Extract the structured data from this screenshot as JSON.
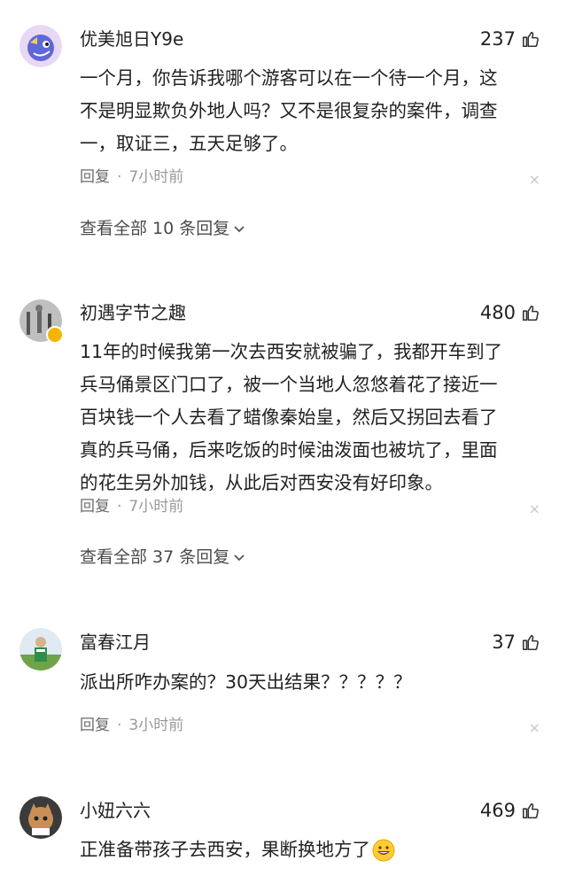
{
  "comments": [
    {
      "username": "优美旭日Y9e",
      "likes": "237",
      "lines": [
        "一个月，你告诉我哪个游客可以在一个待一个月，这",
        "不是明显欺负外地人吗？又不是很复杂的案件，调查",
        "一，取证三，五天足够了。"
      ],
      "reply_label": "回复",
      "separator": "·",
      "time": "7小时前",
      "view_all": "查看全部 10 条回复"
    },
    {
      "username": "初遇字节之趣",
      "likes": "480",
      "lines": [
        "11年的时候我第一次去西安就被骗了，我都开车到了",
        "兵马俑景区门口了，被一个当地人忽悠着花了接近一",
        "百块钱一个人去看了蜡像秦始皇，然后又拐回去看了",
        "真的兵马俑，后来吃饭的时候油泼面也被坑了，里面",
        "的花生另外加钱，从此后对西安没有好印象。"
      ],
      "reply_label": "回复",
      "separator": "·",
      "time": "7小时前",
      "view_all": "查看全部 37 条回复"
    },
    {
      "username": "富春江月",
      "likes": "37",
      "lines": [
        "派出所咋办案的？30天出结果？？？？？"
      ],
      "reply_label": "回复",
      "separator": "·",
      "time": "3小时前"
    },
    {
      "username": "小妞六六",
      "likes": "469",
      "lines": [
        "正准备带孩子去西安，果断换地方了"
      ]
    }
  ],
  "icons": {
    "like": "thumbs-up-icon",
    "close": "close-icon",
    "expand": "chevron-down-icon",
    "emoji": "grinning-face-emoji"
  },
  "close_glyph": "×",
  "colors": {
    "text": "#222222",
    "meta": "#9a9a9a",
    "link": "#4a4a4a"
  }
}
